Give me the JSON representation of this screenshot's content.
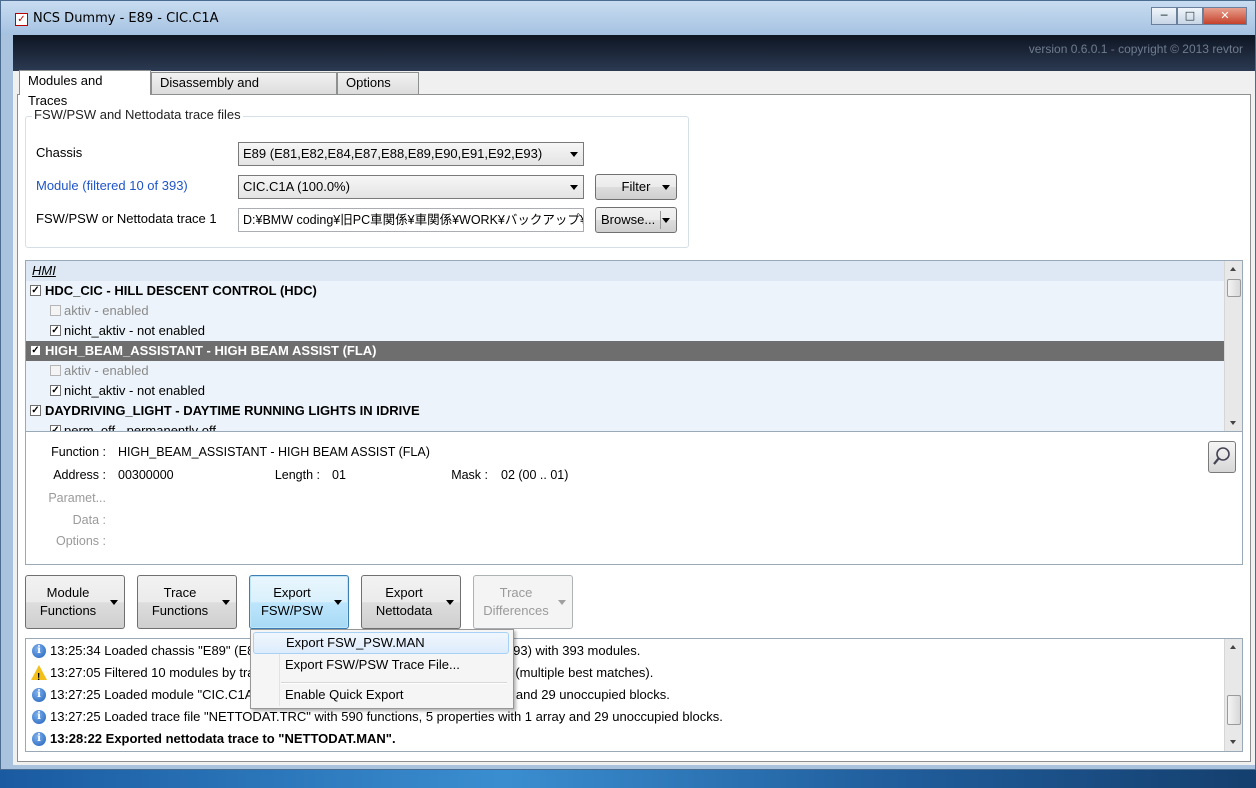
{
  "window": {
    "title": "NCS Dummy - E89 - CIC.C1A",
    "min_label": "─",
    "max_label": "□",
    "close_label": "✕"
  },
  "banner": {
    "version": "version 0.6.0.1 - copyright © 2013 revtor"
  },
  "tabs": [
    {
      "label": "Modules and Traces"
    },
    {
      "label": "Disassembly and Checksums"
    },
    {
      "label": "Options"
    }
  ],
  "files": {
    "legend": "FSW/PSW and Nettodata trace files",
    "chassis_label": "Chassis",
    "chassis_value": "E89  (E81,E82,E84,E87,E88,E89,E90,E91,E92,E93)",
    "module_label": "Module (filtered 10 of 393)",
    "module_value": "CIC.C1A  (100.0%)",
    "filter_label": "Filter",
    "trace_label": "FSW/PSW or Nettodata trace 1",
    "trace_value": "D:¥BMW coding¥旧PC車関係¥車関係¥WORK¥バックアップ¥C",
    "browse_label": "Browse..."
  },
  "tree": {
    "rows": [
      {
        "text": "HMI",
        "checked": null
      },
      {
        "text": "HDC_CIC  -  HILL DESCENT CONTROL (HDC)",
        "checked": true
      },
      {
        "text": "aktiv  -  enabled",
        "checked": false
      },
      {
        "text": "nicht_aktiv  -  not enabled",
        "checked": true
      },
      {
        "text": "HIGH_BEAM_ASSISTANT  -  HIGH BEAM ASSIST (FLA)",
        "checked": true
      },
      {
        "text": "aktiv  -  enabled",
        "checked": false
      },
      {
        "text": "nicht_aktiv  -  not enabled",
        "checked": true
      },
      {
        "text": "DAYDRIVING_LIGHT  -  DAYTIME RUNNING LIGHTS IN IDRIVE",
        "checked": true
      },
      {
        "text": "perm_off  -  permanently off",
        "checked": true
      }
    ]
  },
  "details": {
    "function_label": "Function :",
    "function_value": "HIGH_BEAM_ASSISTANT  -  HIGH BEAM ASSIST (FLA)",
    "address_label": "Address :",
    "address_value": "00300000",
    "length_label": "Length :",
    "length_value": "01",
    "mask_label": "Mask :",
    "mask_value": "02  (00 .. 01)",
    "parameters_label": "Paramet...",
    "data_label": "Data :",
    "options_label": "Options :"
  },
  "actions": [
    {
      "line1": "Module",
      "line2": "Functions"
    },
    {
      "line1": "Trace",
      "line2": "Functions"
    },
    {
      "line1": "Export",
      "line2": "FSW/PSW"
    },
    {
      "line1": "Export",
      "line2": "Nettodata"
    },
    {
      "line1": "Trace",
      "line2": "Differences"
    }
  ],
  "log": [
    {
      "icon": "info",
      "text": "13:25:34  Loaded chassis \"E89\" (E81,E82,E84,E87,E88,E89,E90,E91,E92 and E93) with 393 modules."
    },
    {
      "icon": "warning",
      "text": "13:27:05  Filtered 10 modules by trace file. CIC.C1A is the best matching module (multiple best matches)."
    },
    {
      "icon": "info",
      "text": "13:27:25  Loaded module \"CIC.C1A\" with 590 functions, 5 properties with 1 array and 29 unoccupied blocks."
    },
    {
      "icon": "info",
      "text": "13:27:25  Loaded trace file \"NETTODAT.TRC\" with 590 functions, 5 properties with 1 array and 29 unoccupied blocks."
    },
    {
      "icon": "info",
      "text": "13:28:22  Exported nettodata trace to \"NETTODAT.MAN\"."
    }
  ],
  "menu": {
    "items": [
      {
        "label": "Export FSW_PSW.MAN"
      },
      {
        "label": "Export FSW/PSW Trace File..."
      },
      {
        "label": "Enable Quick Export"
      }
    ]
  }
}
